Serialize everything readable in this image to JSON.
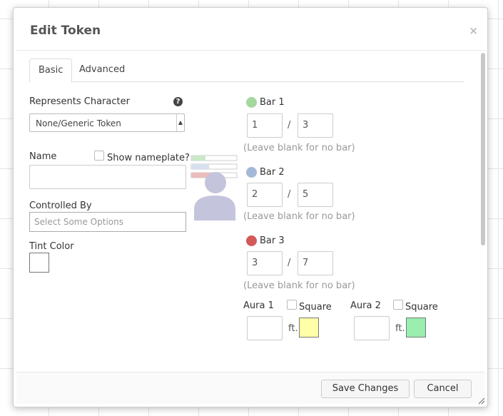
{
  "dialog": {
    "title": "Edit Token",
    "close_glyph": "×",
    "tabs": [
      {
        "label": "Basic",
        "active": true
      },
      {
        "label": "Advanced",
        "active": false
      }
    ]
  },
  "basic": {
    "represents_label": "Represents Character",
    "represents_help": "?",
    "represents_value": "None/Generic Token",
    "name_label": "Name",
    "name_value": "",
    "show_nameplate_label": "Show nameplate?",
    "controlled_label": "Controlled By",
    "controlled_placeholder": "Select Some Options",
    "tint_label": "Tint Color"
  },
  "bars": [
    {
      "label": "Bar 1",
      "color": "#a4d7a0",
      "value": "1",
      "max": "3",
      "hint": "(Leave blank for no bar)"
    },
    {
      "label": "Bar 2",
      "color": "#a4b8d8",
      "value": "2",
      "max": "5",
      "hint": "(Leave blank for no bar)"
    },
    {
      "label": "Bar 3",
      "color": "#d45a5a",
      "value": "3",
      "max": "7",
      "hint": "(Leave blank for no bar)"
    }
  ],
  "bar_separator": "/",
  "auras": [
    {
      "label": "Aura 1",
      "square_label": "Square",
      "value": "",
      "unit": "ft.",
      "color": "#ffffa8"
    },
    {
      "label": "Aura 2",
      "square_label": "Square",
      "value": "",
      "unit": "ft.",
      "color": "#99eeb0"
    }
  ],
  "footer": {
    "save_label": "Save Changes",
    "cancel_label": "Cancel"
  },
  "colors": {
    "avatar": "#c4c4dc"
  }
}
